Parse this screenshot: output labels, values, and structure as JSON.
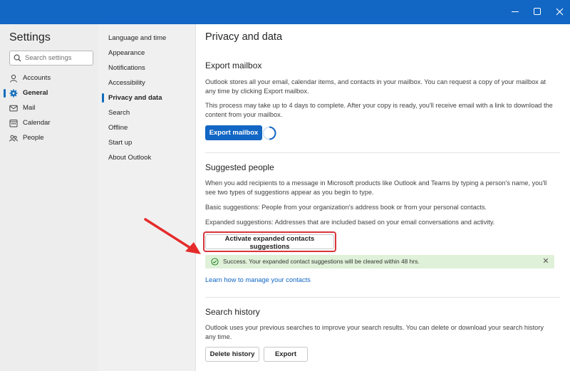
{
  "window": {
    "controls": [
      "minimize-icon",
      "maximize-icon",
      "close-icon"
    ],
    "accent": "#1266c4"
  },
  "settings": {
    "title": "Settings",
    "search_placeholder": "Search settings",
    "categories": [
      {
        "label": "Accounts",
        "icon": "person-icon"
      },
      {
        "label": "General",
        "icon": "gear-icon"
      },
      {
        "label": "Mail",
        "icon": "mail-icon"
      },
      {
        "label": "Calendar",
        "icon": "calendar-icon"
      },
      {
        "label": "People",
        "icon": "people-icon"
      }
    ],
    "active_category": "General"
  },
  "subnav": {
    "items": [
      {
        "label": "Language and time"
      },
      {
        "label": "Appearance"
      },
      {
        "label": "Notifications"
      },
      {
        "label": "Accessibility"
      },
      {
        "label": "Privacy and data"
      },
      {
        "label": "Search"
      },
      {
        "label": "Offline"
      },
      {
        "label": "Start up"
      },
      {
        "label": "About Outlook"
      }
    ],
    "active_item": "Privacy and data"
  },
  "main": {
    "title": "Privacy and data",
    "export": {
      "heading": "Export mailbox",
      "p1": "Outlook stores all your email, calendar items, and contacts in your mailbox. You can request a copy of your mailbox at any time by clicking Export mailbox.",
      "p2": "This process may take up to 4 days to complete. After your copy is ready, you'll receive email with a link to download the content from your mailbox.",
      "button": "Export mailbox"
    },
    "suggested": {
      "heading": "Suggested people",
      "p1": "When you add recipients to a message in Microsoft products like Outlook and Teams by typing a person's name, you'll see two types of suggestions appear as you begin to type.",
      "p2": "Basic suggestions: People from your organization's address book or from your personal contacts.",
      "p3": "Expanded suggestions: Addresses that are included based on your email conversations and activity.",
      "button": "Activate expanded contacts suggestions",
      "success": "Success. Your expanded contact suggestions will be cleared within 48 hrs.",
      "link": "Learn how to manage your contacts"
    },
    "history": {
      "heading": "Search history",
      "p1": "Outlook uses your previous searches to improve your search results. You can delete or download your search history any time.",
      "delete_button": "Delete history",
      "export_button": "Export"
    }
  }
}
